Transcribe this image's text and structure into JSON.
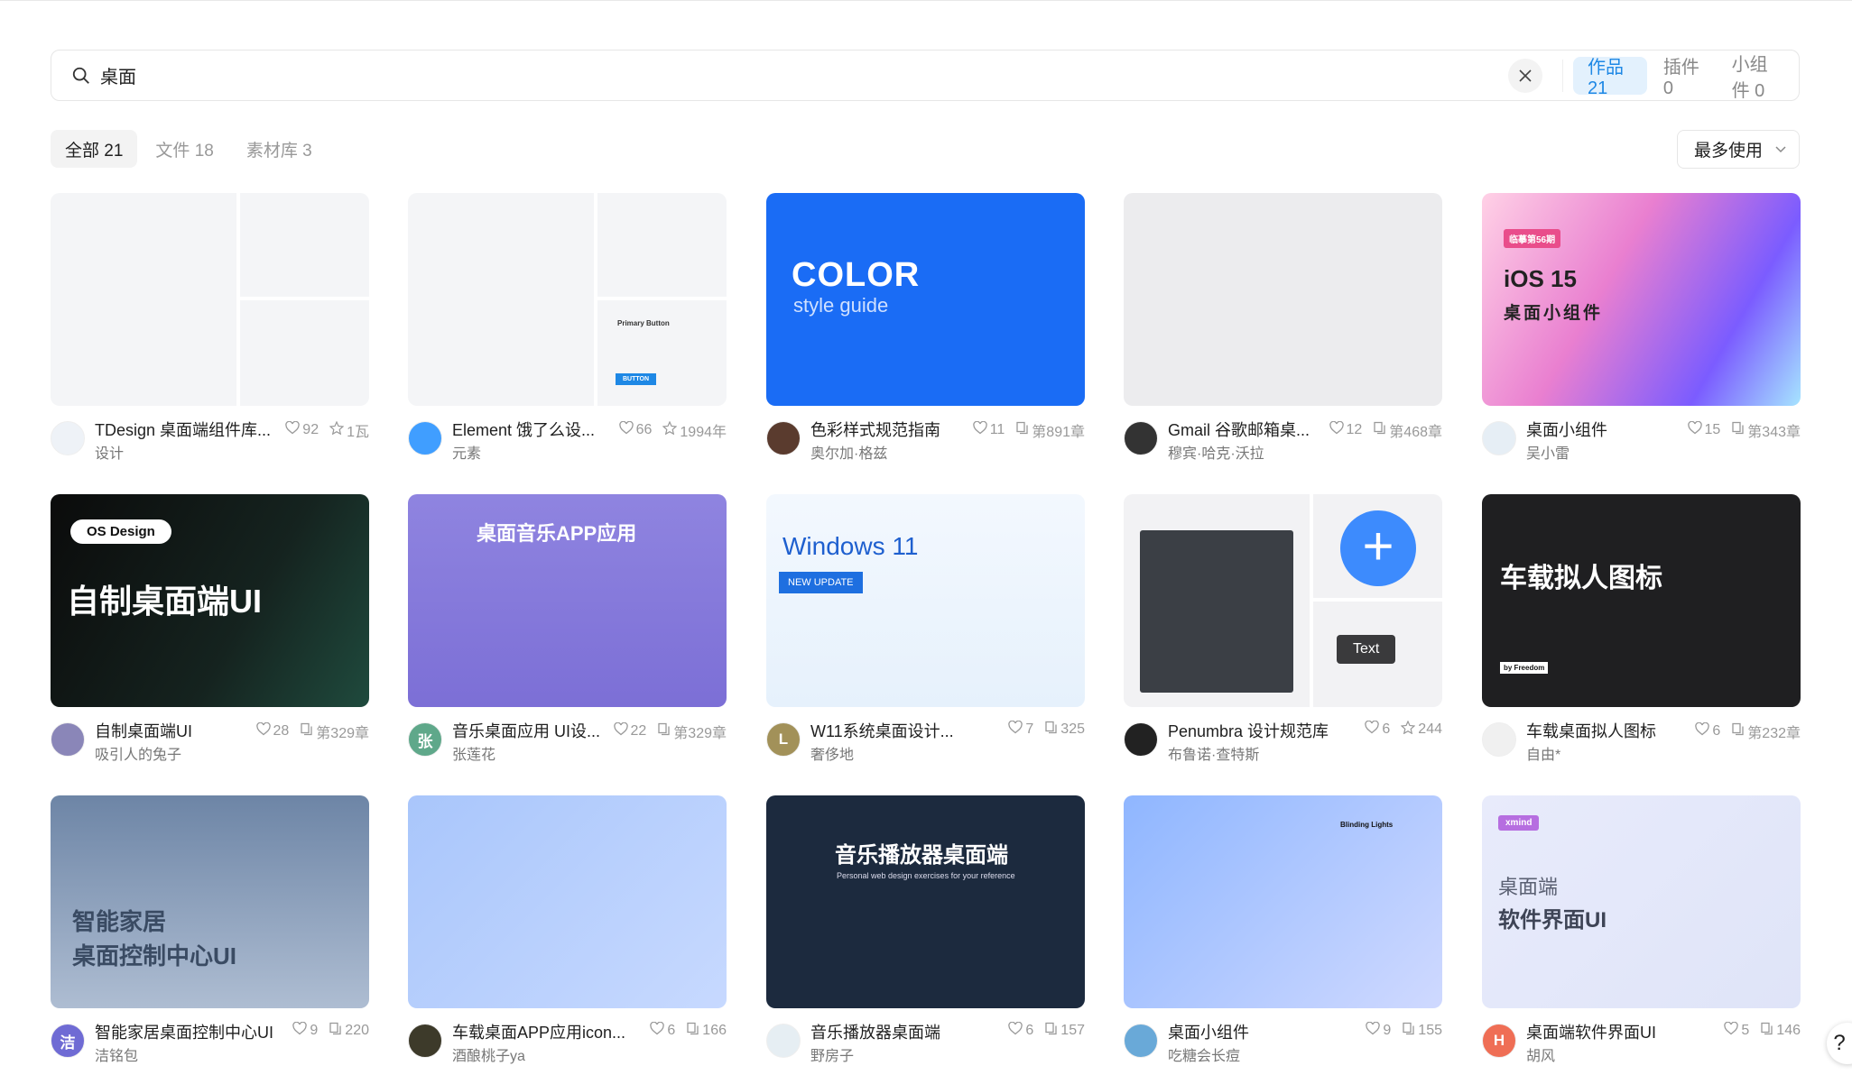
{
  "search": {
    "value": "桌面",
    "placeholder": ""
  },
  "scope_tabs": [
    {
      "label": "作品 21",
      "active": true
    },
    {
      "label": "插件 0",
      "active": false
    },
    {
      "label": "小组件 0",
      "active": false
    }
  ],
  "filter_tabs": [
    {
      "label": "全部 21",
      "active": true
    },
    {
      "label": "文件 18",
      "active": false
    },
    {
      "label": "素材库 3",
      "active": false
    }
  ],
  "sort": {
    "label": "最多使用"
  },
  "help": {
    "label": "?"
  },
  "accent": "#1e88e5",
  "cards": [
    {
      "title": "TDesign 桌面端组件库...",
      "author": "设计",
      "likes": "92",
      "stat2": "1瓦",
      "stat2_icon": "star-icon",
      "avatar_text": "",
      "avatar_color": "#eef2f7",
      "thumb": {
        "bg": "#f4f5f7",
        "texts": []
      }
    },
    {
      "title": "Element 饿了么设...",
      "author": "元素",
      "likes": "66",
      "stat2": "1994年",
      "stat2_icon": "star-icon",
      "avatar_text": "",
      "avatar_color": "#409eff",
      "thumb": {
        "bg": "#f4f5f7",
        "texts": [
          "Primary Button",
          "BUTTON"
        ]
      }
    },
    {
      "title": "色彩样式规范指南",
      "author": "奥尔加·格兹",
      "likes": "11",
      "stat2": "第891章",
      "stat2_icon": "copy-icon",
      "avatar_text": "",
      "avatar_color": "#5a3b2e",
      "thumb": {
        "bg": "#1a6cf5",
        "texts": [
          "COLOR",
          "style guide"
        ]
      }
    },
    {
      "title": "Gmail 谷歌邮箱桌...",
      "author": "穆宾·哈克·沃拉",
      "likes": "12",
      "stat2": "第468章",
      "stat2_icon": "copy-icon",
      "avatar_text": "",
      "avatar_color": "#333333",
      "thumb": {
        "bg": "#ececee",
        "texts": []
      }
    },
    {
      "title": "桌面小组件",
      "author": "吴小雷",
      "likes": "15",
      "stat2": "第343章",
      "stat2_icon": "copy-icon",
      "avatar_text": "",
      "avatar_color": "#e6eef5",
      "thumb": {
        "bg": "linear-gradient(120deg,#ffd1e6,#e97fd0 40%,#7b5cff 75%,#a6e4ff)",
        "texts": [
          "iOS 15",
          "桌面小组件",
          "临摹第56期"
        ]
      }
    },
    {
      "title": "自制桌面端UI",
      "author": "吸引人的兔子",
      "likes": "28",
      "stat2": "第329章",
      "stat2_icon": "copy-icon",
      "avatar_text": "",
      "avatar_color": "#8a86b8",
      "thumb": {
        "bg": "linear-gradient(120deg,#0b0b0b,#15231f 60%,#1f4a3d)",
        "texts": [
          "OS Design",
          "自制桌面端UI"
        ]
      }
    },
    {
      "title": "音乐桌面应用 UI设...",
      "author": "张莲花",
      "likes": "22",
      "stat2": "第329章",
      "stat2_icon": "copy-icon",
      "avatar_text": "张",
      "avatar_color": "#5fa88a",
      "thumb": {
        "bg": "linear-gradient(180deg,#8f84e0,#7c6fd6)",
        "texts": [
          "桌面音乐APP应用"
        ]
      }
    },
    {
      "title": "W11系统桌面设计...",
      "author": "奢侈地",
      "likes": "7",
      "stat2": "325",
      "stat2_icon": "copy-icon",
      "avatar_text": "L",
      "avatar_color": "#a29159",
      "thumb": {
        "bg": "linear-gradient(180deg,#f3f8fe,#e6f1fc)",
        "texts": [
          "Windows 11",
          "NEW UPDATE"
        ]
      }
    },
    {
      "title": "Penumbra 设计规范库",
      "author": "布鲁诺·查特斯",
      "likes": "6",
      "stat2": "244",
      "stat2_icon": "star-icon",
      "avatar_text": "",
      "avatar_color": "#222222",
      "thumb": {
        "bg": "#f2f2f4",
        "texts": [
          "Text"
        ]
      }
    },
    {
      "title": "车载桌面拟人图标",
      "author": "自由*",
      "likes": "6",
      "stat2": "第232章",
      "stat2_icon": "copy-icon",
      "avatar_text": "",
      "avatar_color": "#f0f0f0",
      "thumb": {
        "bg": "#1f1f21",
        "texts": [
          "车载拟人图标",
          "by Freedom"
        ]
      }
    },
    {
      "title": "智能家居桌面控制中心UI",
      "author": "洁铭包",
      "likes": "9",
      "stat2": "220",
      "stat2_icon": "copy-icon",
      "avatar_text": "洁",
      "avatar_color": "#6f6bd4",
      "thumb": {
        "bg": "linear-gradient(180deg,#6d85a6,#aebdd2)",
        "texts": [
          "智能家居",
          "桌面控制中心UI"
        ]
      }
    },
    {
      "title": "车载桌面APP应用icon...",
      "author": "酒酿桃子ya",
      "likes": "6",
      "stat2": "166",
      "stat2_icon": "copy-icon",
      "avatar_text": "",
      "avatar_color": "#3d3a2a",
      "thumb": {
        "bg": "linear-gradient(135deg,#a9c6fb,#c7d9ff)",
        "texts": []
      }
    },
    {
      "title": "音乐播放器桌面端",
      "author": "野房子",
      "likes": "6",
      "stat2": "157",
      "stat2_icon": "copy-icon",
      "avatar_text": "",
      "avatar_color": "#e6eef3",
      "thumb": {
        "bg": "#1c2a3e",
        "texts": [
          "音乐播放器桌面端",
          "Personal web design exercises for your reference"
        ]
      }
    },
    {
      "title": "桌面小组件",
      "author": "吃糖会长痘",
      "likes": "9",
      "stat2": "155",
      "stat2_icon": "copy-icon",
      "avatar_text": "",
      "avatar_color": "#69a9d8",
      "thumb": {
        "bg": "linear-gradient(135deg,#8fb6ff,#cfd9ff)",
        "texts": [
          "Blinding Lights"
        ]
      }
    },
    {
      "title": "桌面端软件界面UI",
      "author": "胡风",
      "likes": "5",
      "stat2": "146",
      "stat2_icon": "copy-icon",
      "avatar_text": "H",
      "avatar_color": "#ef6e55",
      "thumb": {
        "bg": "linear-gradient(135deg,#e8ebfb,#dfe4f8)",
        "texts": [
          "桌面端",
          "软件界面UI",
          "xmind"
        ]
      }
    }
  ]
}
